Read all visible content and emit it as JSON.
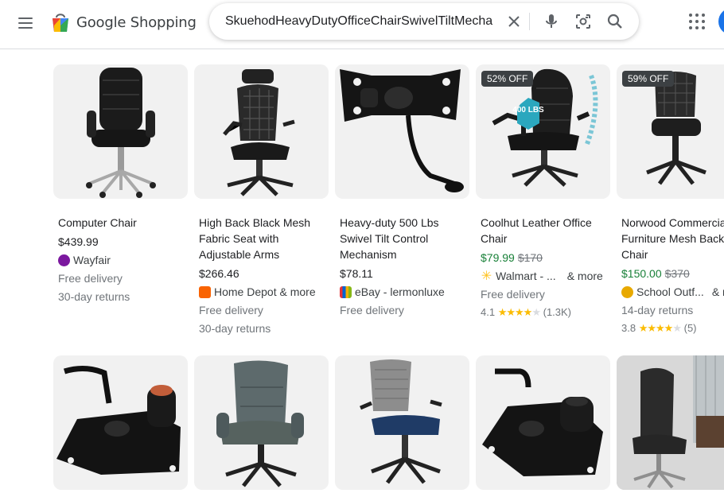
{
  "header": {
    "logo_text": "Google Shopping",
    "search_value": "SkuehodHeavyDutyOfficeChairSwivelTiltMecha",
    "icons": [
      "menu-icon",
      "clear-icon",
      "microphone-icon",
      "lens-icon",
      "search-icon",
      "apps-grid-icon"
    ]
  },
  "products": [
    {
      "title": "Computer Chair",
      "price": "$439.99",
      "seller": "Wayfair",
      "delivery": "Free delivery",
      "returns": "30-day returns"
    },
    {
      "title": "High Back Black Mesh Fabric Seat with Adjustable Arms",
      "price": "$266.46",
      "seller": "Home Depot & more",
      "delivery": "Free delivery",
      "returns": "30-day returns"
    },
    {
      "title": "Heavy-duty 500 Lbs Swivel Tilt Control Mechanism",
      "price": "$78.11",
      "seller": "eBay - lermonluxe",
      "delivery": "Free delivery"
    },
    {
      "title": "Coolhut Leather Office Chair",
      "badge": "52% OFF",
      "image_text": "400 LBS",
      "price": "$79.99",
      "old_price": "$170",
      "seller": "Walmart - ...",
      "seller_more": "& more",
      "delivery": "Free delivery",
      "rating": "4.1",
      "stars": 4.1,
      "reviews": "(1.3K)"
    },
    {
      "title": "Norwood Commercial Furniture Mesh Back Task Chair",
      "badge": "59% OFF",
      "price": "$150.00",
      "old_price": "$370",
      "seller": "School Outf...",
      "seller_more": "& m",
      "returns": "14-day returns",
      "rating": "3.8",
      "stars": 3.8,
      "reviews": "(5)"
    }
  ],
  "colors": {
    "sale_price": "#188038",
    "star": "#fbbc04",
    "badge_bg": "#3c4043",
    "wayfair": "#7b189f",
    "home_depot": "#f96302",
    "walmart": "#ffc220",
    "school_outfitters": "#e8a900"
  }
}
